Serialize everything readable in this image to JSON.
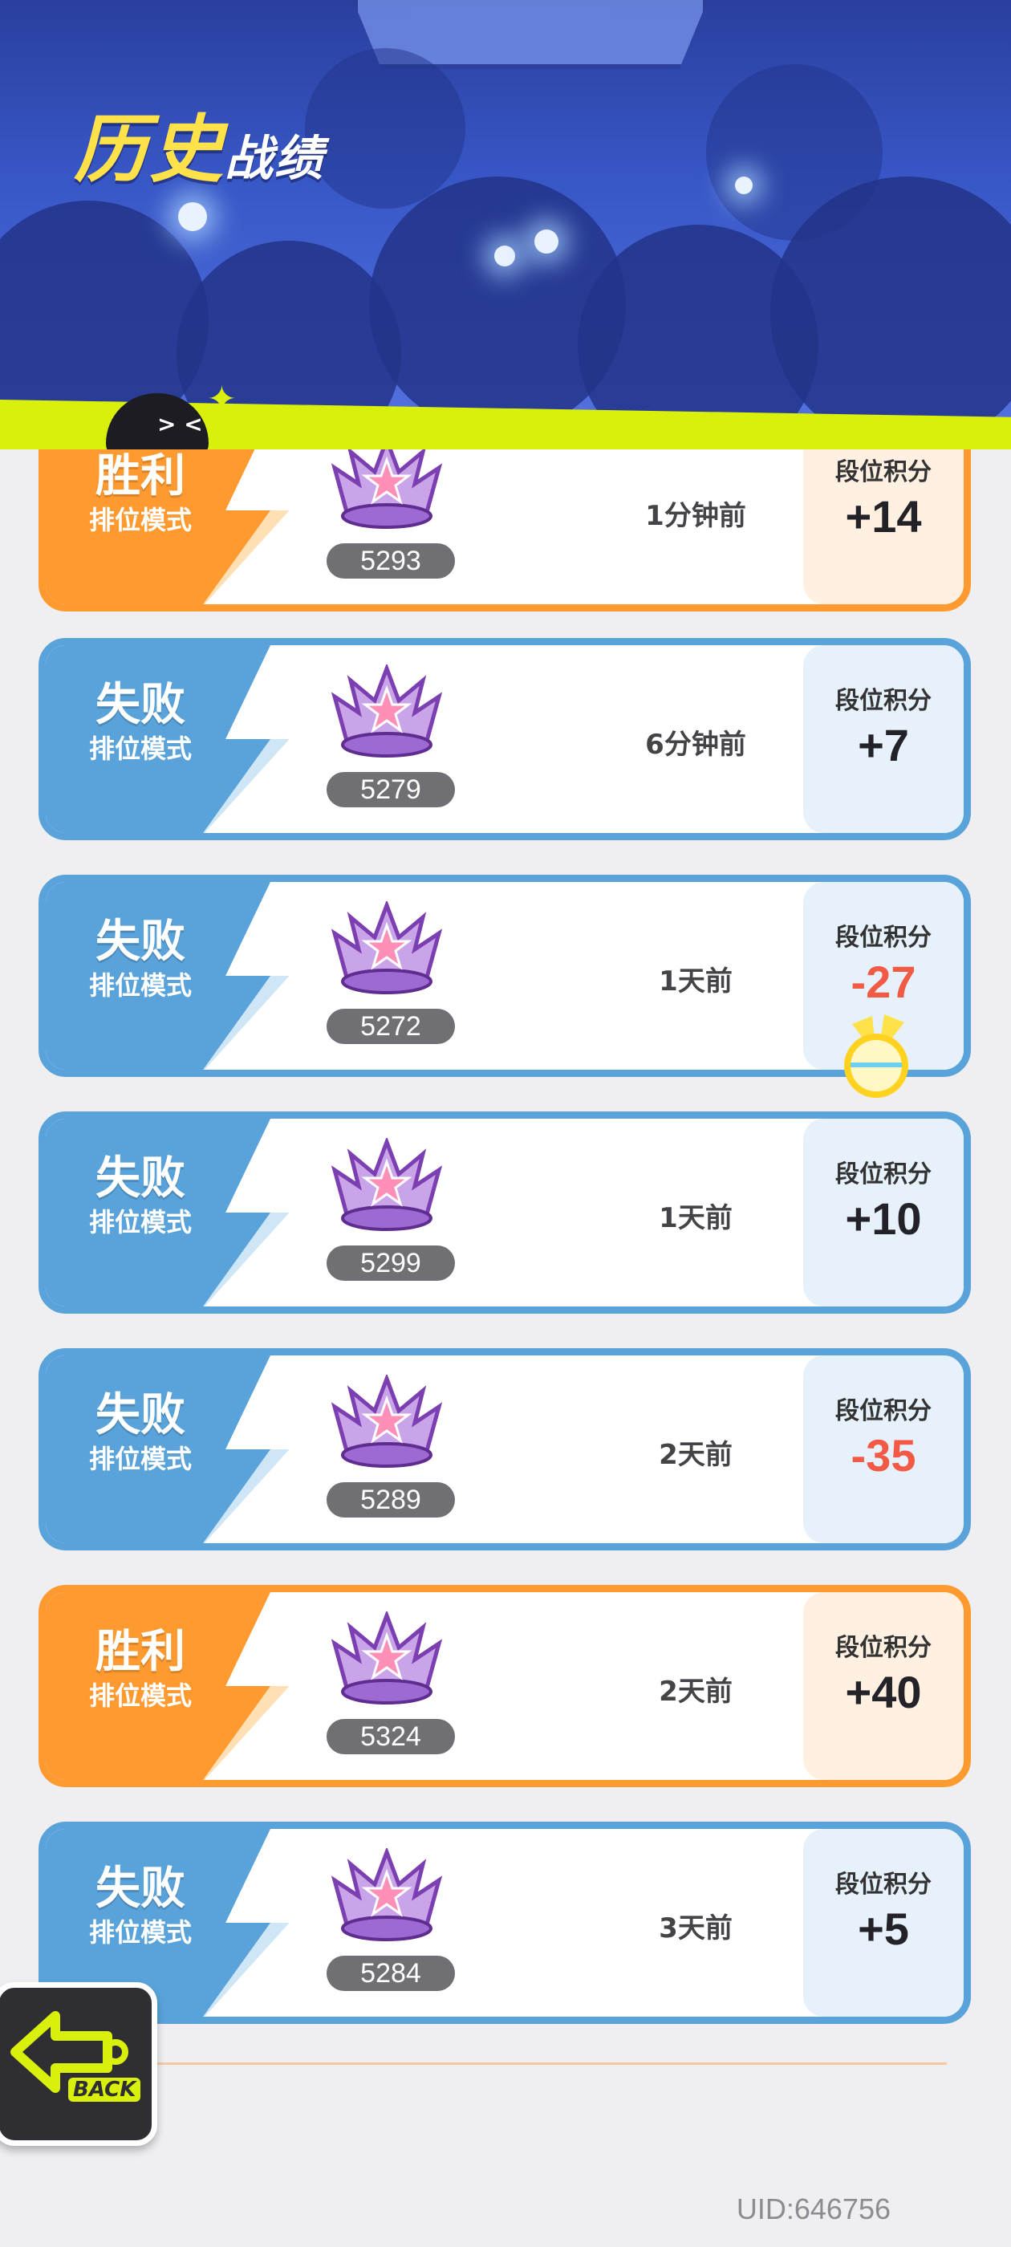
{
  "header": {
    "title_big": "历史",
    "title_small": "战绩"
  },
  "score_label": "段位积分",
  "records": [
    {
      "result": "胜利",
      "mode": "排位模式",
      "rank_points": "5293",
      "time": "1分钟前",
      "score": "+14",
      "type": "win"
    },
    {
      "result": "失败",
      "mode": "排位模式",
      "rank_points": "5279",
      "time": "6分钟前",
      "score": "+7",
      "type": "loss"
    },
    {
      "result": "失败",
      "mode": "排位模式",
      "rank_points": "5272",
      "time": "1天前",
      "score": "-27",
      "type": "loss"
    },
    {
      "result": "失败",
      "mode": "排位模式",
      "rank_points": "5299",
      "time": "1天前",
      "score": "+10",
      "type": "loss"
    },
    {
      "result": "失败",
      "mode": "排位模式",
      "rank_points": "5289",
      "time": "2天前",
      "score": "-35",
      "type": "loss"
    },
    {
      "result": "胜利",
      "mode": "排位模式",
      "rank_points": "5324",
      "time": "2天前",
      "score": "+40",
      "type": "win"
    },
    {
      "result": "失败",
      "mode": "排位模式",
      "rank_points": "5284",
      "time": "3天前",
      "score": "+5",
      "type": "loss"
    }
  ],
  "back_button": {
    "label": "BACK"
  },
  "uid": "UID:646756",
  "colors": {
    "win": "#ff9a30",
    "loss": "#5aa3da",
    "accent": "#d9f00c",
    "negative": "#f25a45"
  },
  "icons": {
    "trophy": "trophy-icon",
    "back": "back-arrow-icon",
    "mascot": "mascot-icon",
    "coin": "coin-icon"
  }
}
